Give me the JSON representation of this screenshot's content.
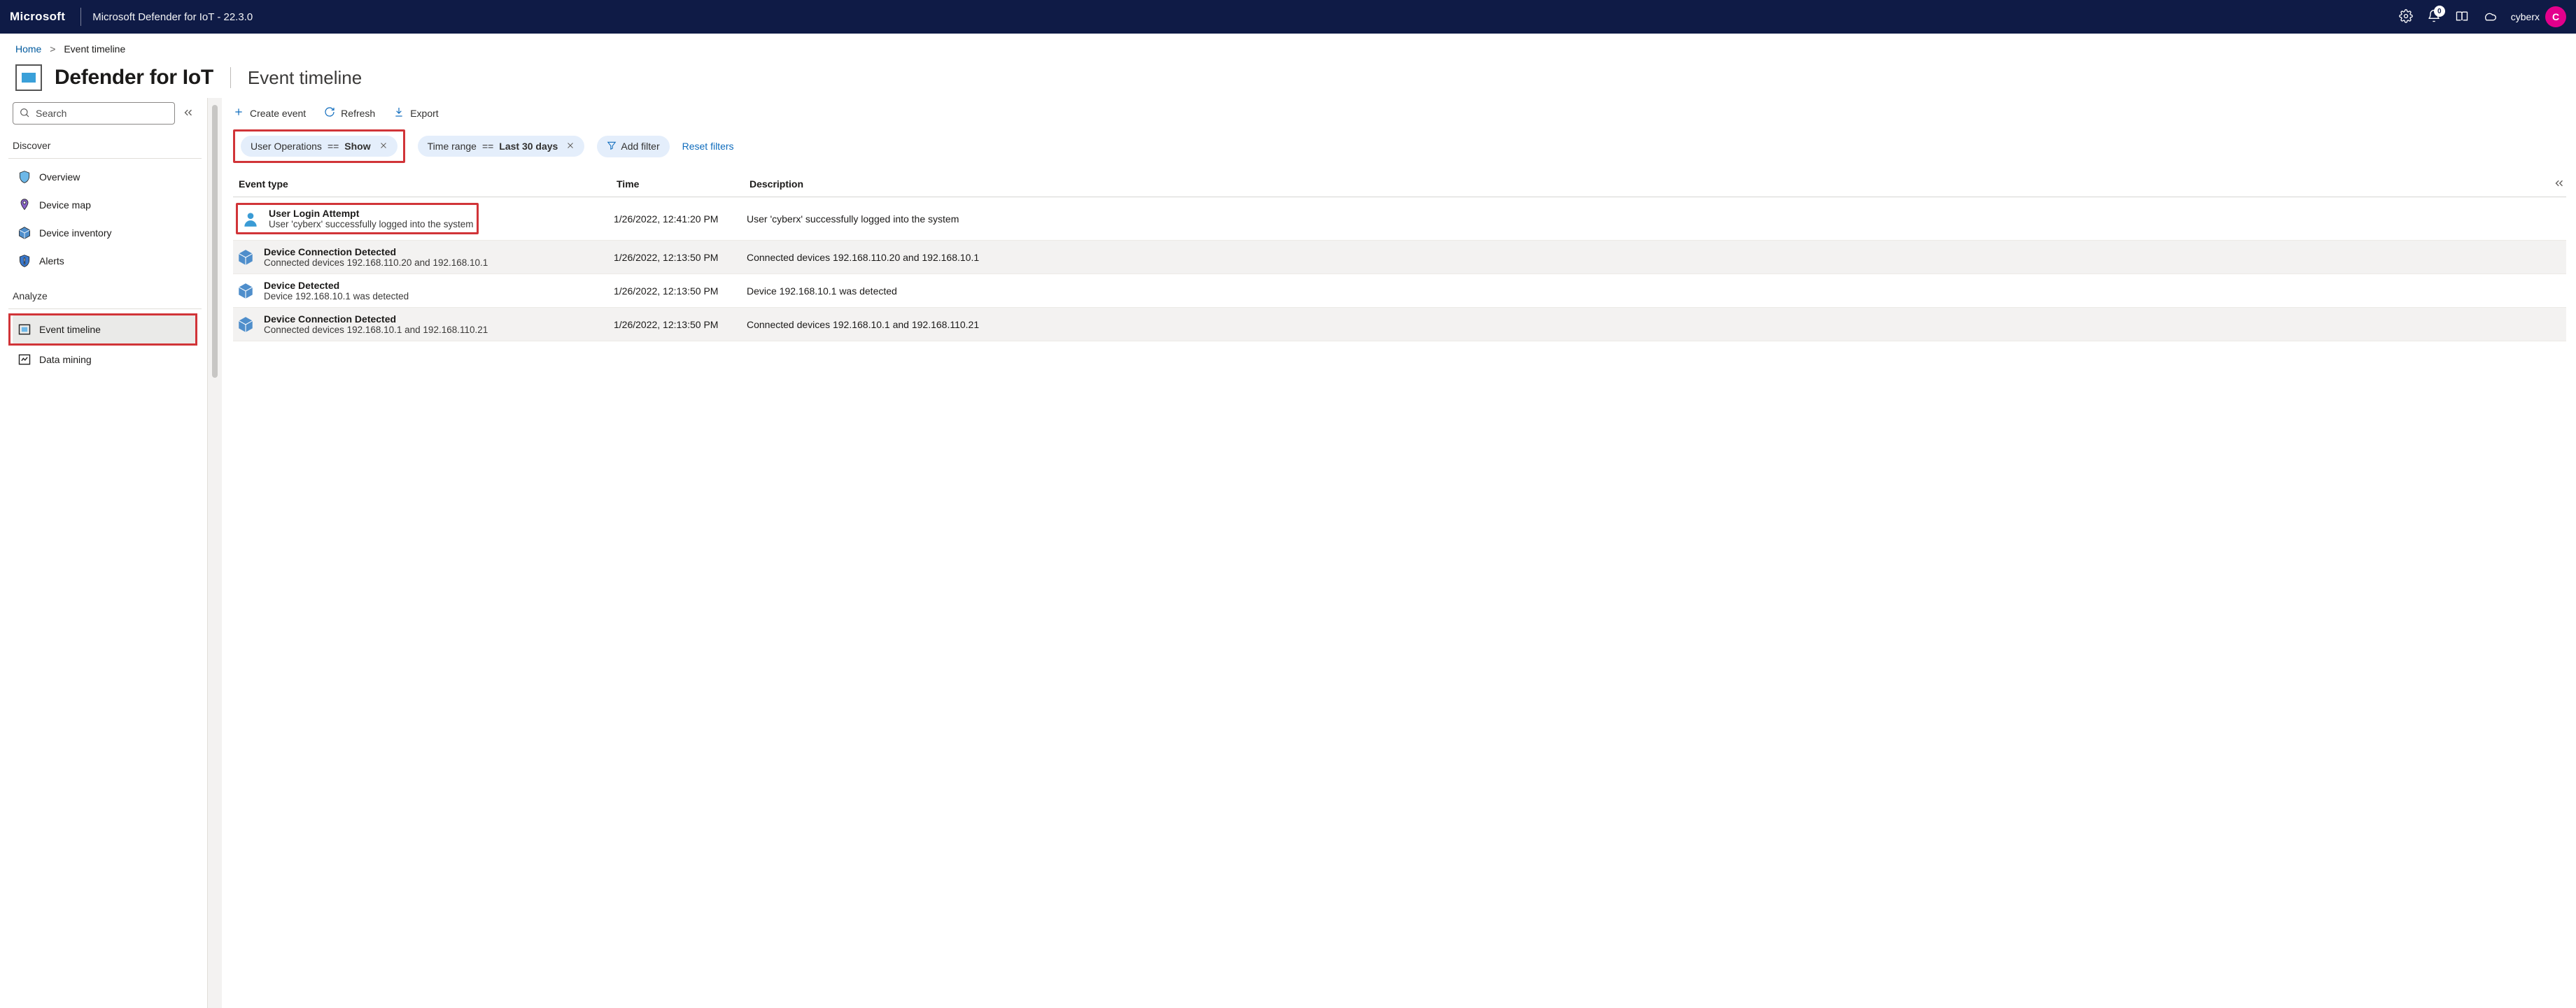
{
  "topbar": {
    "brand": "Microsoft",
    "product": "Microsoft Defender for IoT - 22.3.0",
    "notifications_count": "0",
    "user_name": "cyberx",
    "avatar_initial": "C"
  },
  "breadcrumb": {
    "home": "Home",
    "current": "Event timeline"
  },
  "page": {
    "app_title": "Defender for IoT",
    "subtitle": "Event timeline"
  },
  "sidebar": {
    "search_placeholder": "Search",
    "sections": {
      "discover_label": "Discover",
      "analyze_label": "Analyze"
    },
    "items": {
      "overview": "Overview",
      "device_map": "Device map",
      "device_inventory": "Device inventory",
      "alerts": "Alerts",
      "event_timeline": "Event timeline",
      "data_mining": "Data mining"
    }
  },
  "cmdbar": {
    "create_event": "Create event",
    "refresh": "Refresh",
    "export": "Export"
  },
  "filters": {
    "user_ops_key": "User Operations",
    "user_ops_eq": "==",
    "user_ops_val": "Show",
    "time_range_key": "Time range",
    "time_range_eq": "==",
    "time_range_val": "Last 30 days",
    "add_filter_label": "Add filter",
    "reset_label": "Reset filters"
  },
  "table": {
    "headers": {
      "event_type": "Event type",
      "time": "Time",
      "description": "Description"
    },
    "rows": [
      {
        "icon": "user",
        "title": "User Login Attempt",
        "sub": "User 'cyberx' successfully logged into the system",
        "time": "1/26/2022, 12:41:20 PM",
        "desc": "User 'cyberx' successfully logged into the system",
        "alt": false,
        "callout": true
      },
      {
        "icon": "device",
        "title": "Device Connection Detected",
        "sub": "Connected devices 192.168.110.20 and 192.168.10.1",
        "time": "1/26/2022, 12:13:50 PM",
        "desc": "Connected devices 192.168.110.20 and 192.168.10.1",
        "alt": true,
        "callout": false
      },
      {
        "icon": "device",
        "title": "Device Detected",
        "sub": "Device 192.168.10.1 was detected",
        "time": "1/26/2022, 12:13:50 PM",
        "desc": "Device 192.168.10.1 was detected",
        "alt": false,
        "callout": false
      },
      {
        "icon": "device",
        "title": "Device Connection Detected",
        "sub": "Connected devices 192.168.10.1 and 192.168.110.21",
        "time": "1/26/2022, 12:13:50 PM",
        "desc": "Connected devices 192.168.10.1 and 192.168.110.21",
        "alt": true,
        "callout": false
      }
    ]
  }
}
